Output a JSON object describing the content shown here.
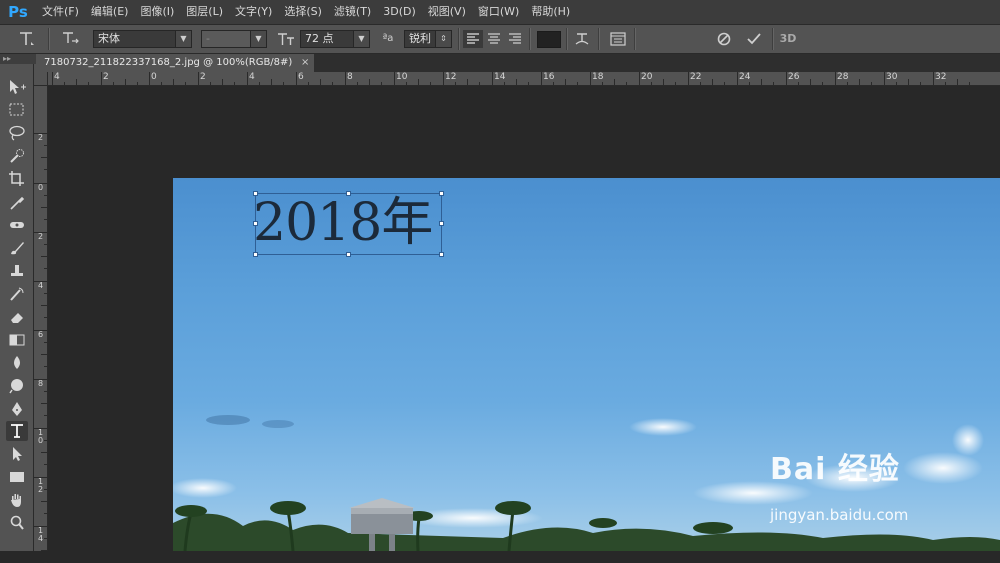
{
  "app": {
    "logo": "Ps"
  },
  "menu": [
    "文件(F)",
    "编辑(E)",
    "图像(I)",
    "图层(L)",
    "文字(Y)",
    "选择(S)",
    "滤镜(T)",
    "3D(D)",
    "视图(V)",
    "窗口(W)",
    "帮助(H)"
  ],
  "options": {
    "font_family": "宋体",
    "font_style": "-",
    "font_size": "72 点",
    "aa_label": "ªa",
    "anti_alias": "锐利",
    "three_d": "3D",
    "text_color": "#222222"
  },
  "document": {
    "tab_title": "7180732_211822337168_2.jpg @ 100%(RGB/8#)"
  },
  "rulers": {
    "h_labels": [
      "4",
      "2",
      "0",
      "2",
      "4",
      "6",
      "8",
      "10",
      "12",
      "14",
      "16",
      "18",
      "20",
      "22",
      "24",
      "26",
      "28",
      "30",
      "32"
    ],
    "v_labels": [
      "2",
      "0",
      "2",
      "4",
      "6",
      "8",
      "10",
      "12",
      "14"
    ]
  },
  "canvas": {
    "text": "2018年"
  },
  "watermark": {
    "brand": "Bai 经验",
    "url": "jingyan.baidu.com"
  },
  "tools": [
    "move-tool-icon",
    "marquee-tool-icon",
    "lasso-tool-icon",
    "quick-select-tool-icon",
    "crop-tool-icon",
    "eyedropper-tool-icon",
    "healing-brush-tool-icon",
    "brush-tool-icon",
    "clone-stamp-tool-icon",
    "history-brush-tool-icon",
    "eraser-tool-icon",
    "gradient-tool-icon",
    "blur-tool-icon",
    "dodge-tool-icon",
    "pen-tool-icon",
    "type-tool-icon",
    "path-select-tool-icon",
    "rectangle-tool-icon",
    "hand-tool-icon",
    "zoom-tool-icon"
  ]
}
